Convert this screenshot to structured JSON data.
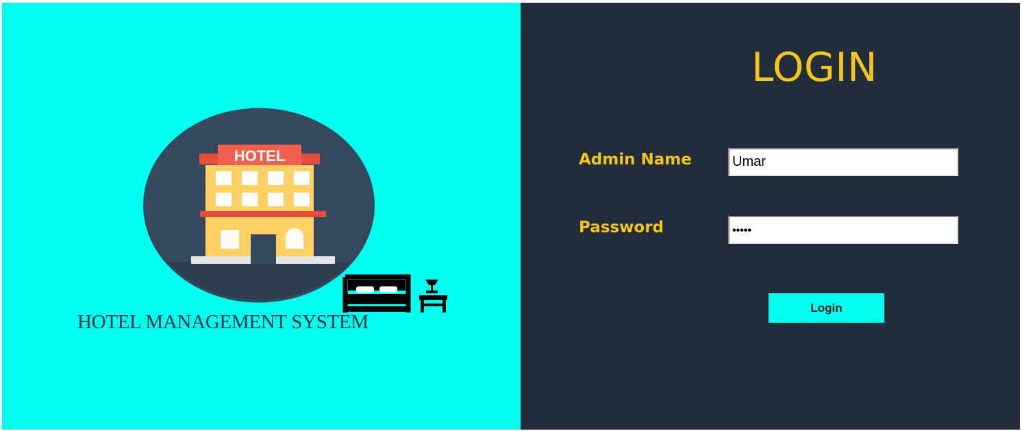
{
  "left_panel": {
    "logo_sign_text": "HOTEL",
    "caption": "HOTEL MANAGEMENT SYSTEM"
  },
  "login_form": {
    "title": "LOGIN",
    "admin_name_label": "Admin Name",
    "admin_name_value": "Umar",
    "password_label": "Password",
    "password_masked": "•••••",
    "login_button_label": "Login"
  },
  "icons": {
    "logo": "hotel-building-icon",
    "bed": "bed-icon",
    "nightstand": "nightstand-lamp-icon"
  },
  "colors": {
    "left_background": "#00FFEE",
    "right_background": "#222D3B",
    "accent_yellow": "#F5C518",
    "button_background": "#00FFEE"
  }
}
